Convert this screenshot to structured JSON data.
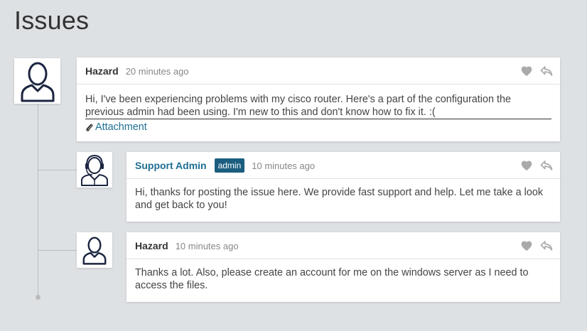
{
  "page": {
    "title": "Issues"
  },
  "comments": [
    {
      "author": "Hazard",
      "time": "20 minutes ago",
      "body": "Hi, I've been experiencing problems with my cisco router. Here's a part of the configuration the previous admin had been using. I'm new to this and don't know how to fix it. :(",
      "attachment": "Attachment",
      "avatar": "user-outline-icon"
    },
    {
      "author": "Support Admin",
      "badge": "admin",
      "time": "10 minutes ago",
      "body": "Hi, thanks for posting the issue here. We provide fast support and help. Let me take a look and get back to you!",
      "avatar": "support-agent-icon"
    },
    {
      "author": "Hazard",
      "time": "10 minutes ago",
      "body": "Thanks a lot. Also, please create an account for me on the windows server as I need to access the files.",
      "avatar": "user-outline-icon"
    }
  ],
  "icons": {
    "like": "heart-icon",
    "reply": "reply-icon",
    "attachment": "paperclip-icon"
  },
  "colors": {
    "background": "#dee1e4",
    "admin_name": "#1f6e94",
    "badge_bg": "#1b5e80",
    "link": "#1f6e94"
  }
}
